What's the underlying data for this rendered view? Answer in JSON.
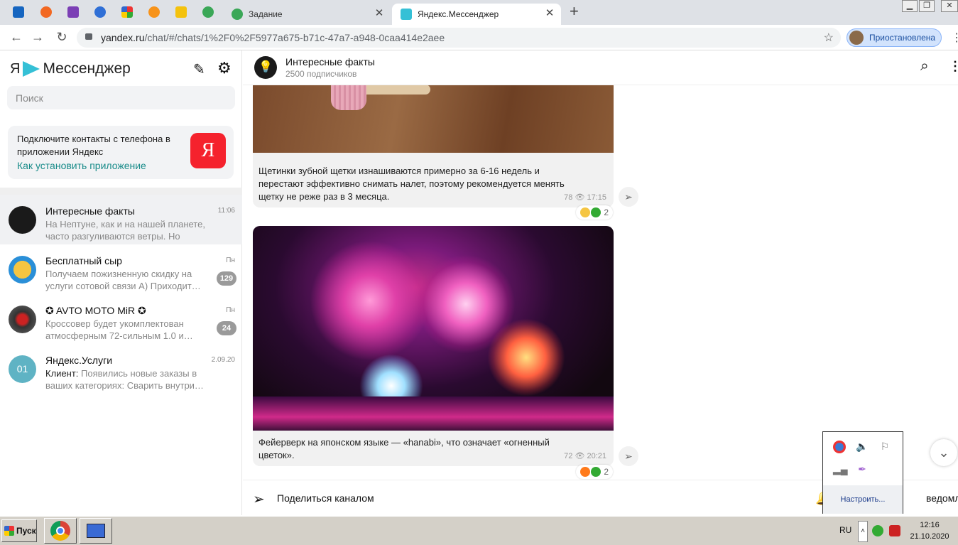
{
  "browser": {
    "tabs": [
      {
        "title": "Задание"
      },
      {
        "title": "Яндекс.Мессенджер"
      }
    ],
    "new_tab_label": "+",
    "close_label": "✕",
    "url_host": "yandex.ru",
    "url_path": "/chat/#/chats/1%2F0%2F5977a675-b71c-47a7-a948-0caa414e2aee",
    "profile_label": "Приостановлена"
  },
  "sidebar": {
    "logo_ya": "Я",
    "logo_text": "Мессенджер",
    "search_placeholder": "Поиск",
    "promo": {
      "text": "Подключите контакты с телефона в приложении Яндекс",
      "link": "Как установить приложение",
      "badge": "Я"
    },
    "chats": [
      {
        "name": "Интересные факты",
        "time": "11:06",
        "preview": "На Нептуне, как и на нашей планете, часто разгуливаются ветры. Но намного…",
        "count": ""
      },
      {
        "name": "Бесплатный сыр",
        "time": "Пн",
        "preview": "Получаем пожизненную скидку на услуги сотовой связи А) Приходит…",
        "count": "129"
      },
      {
        "name": "✪ AVTO MOTO MiR ✪",
        "time": "Пн",
        "preview": "Кроссовер будет укомплектован атмосферным 72-сильным 1.0 и…",
        "count": "24"
      },
      {
        "name": "Яндекс.Услуги",
        "time": "2.09.20",
        "preview_author": "Клиент:",
        "preview": " Появились новые заказы в ваших категориях: Сварить внутри…",
        "count": "",
        "avatar_text": "01"
      }
    ]
  },
  "channel": {
    "title": "Интересные факты",
    "subscribers": "2500 подписчиков",
    "messages": [
      {
        "text": "Щетинки зубной щетки изнашиваются примерно за 6-16 недель и перестают эффективно снимать налет, поэтому рекомендуется менять щетку не реже раз в 3 месяца.",
        "views": "78",
        "time": "17:15",
        "reactions": "2"
      },
      {
        "text": "Фейерверк на японском языке — «hanabi», что означает «огненный цветок».",
        "views": "72",
        "time": "20:21",
        "reactions": "2"
      }
    ],
    "share_label": "Поделиться каналом",
    "notifications_label": "ведомления"
  },
  "tray_popup": {
    "configure_label": "Настроить..."
  },
  "taskbar": {
    "start_label": "Пуск",
    "lang": "RU",
    "time": "12:16",
    "date": "21.10.2020"
  },
  "colors": {
    "accent": "#1a8c8a",
    "promo_badge": "#f5222d",
    "unread_badge": "#9a9a9a"
  }
}
